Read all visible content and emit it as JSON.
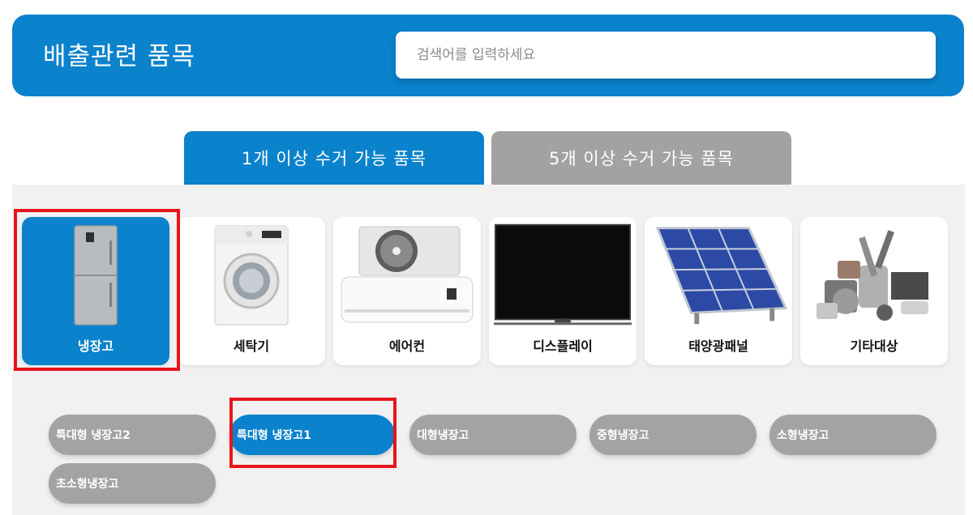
{
  "header": {
    "title": "배출관련 품목",
    "search_placeholder": "검색어를 입력하세요"
  },
  "tabs": [
    {
      "label": "1개 이상 수거 가능 품목",
      "active": true
    },
    {
      "label": "5개 이상 수거 가능 품목",
      "active": false
    }
  ],
  "categories": [
    {
      "label": "냉장고",
      "icon": "refrigerator-image",
      "active": true
    },
    {
      "label": "세탁기",
      "icon": "washing-machine-image",
      "active": false
    },
    {
      "label": "에어컨",
      "icon": "air-conditioner-image",
      "active": false
    },
    {
      "label": "디스플레이",
      "icon": "display-image",
      "active": false
    },
    {
      "label": "태양광패널",
      "icon": "solar-panel-image",
      "active": false
    },
    {
      "label": "기타대상",
      "icon": "misc-appliances-image",
      "active": false
    }
  ],
  "subcategories": [
    {
      "label": "특대형 냉장고2",
      "active": false
    },
    {
      "label": "특대형 냉장고1",
      "active": true
    },
    {
      "label": "대형냉장고",
      "active": false
    },
    {
      "label": "중형냉장고",
      "active": false
    },
    {
      "label": "소형냉장고",
      "active": false
    },
    {
      "label": "초소형냉장고",
      "active": false
    }
  ],
  "colors": {
    "accent": "#0a82cc",
    "inactive": "#a3a3a3",
    "highlight": "#e8141c",
    "panel": "#f1f1f1"
  }
}
